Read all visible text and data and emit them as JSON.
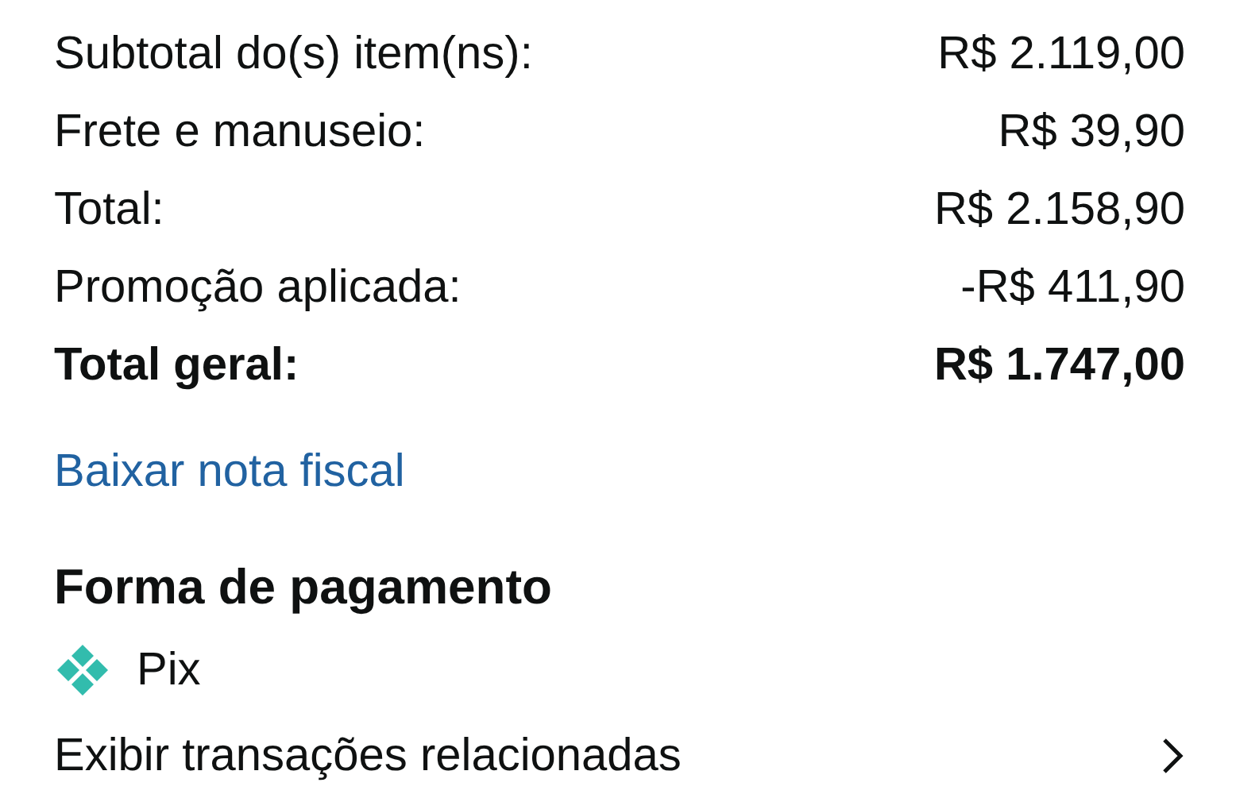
{
  "summary": [
    {
      "label": "Subtotal do(s) item(ns):",
      "value": "R$ 2.119,00",
      "kind": "normal"
    },
    {
      "label": "Frete e manuseio:",
      "value": "R$ 39,90",
      "kind": "normal"
    },
    {
      "label": "Total:",
      "value": "R$ 2.158,90",
      "kind": "normal"
    },
    {
      "label": "Promoção aplicada:",
      "value": "-R$ 411,90",
      "kind": "normal"
    },
    {
      "label": "Total geral:",
      "value": "R$ 1.747,00",
      "kind": "total"
    }
  ],
  "invoice_link": "Baixar nota fiscal",
  "payment": {
    "heading": "Forma de pagamento",
    "method": "Pix",
    "transactions_link": "Exibir transações relacionadas"
  }
}
